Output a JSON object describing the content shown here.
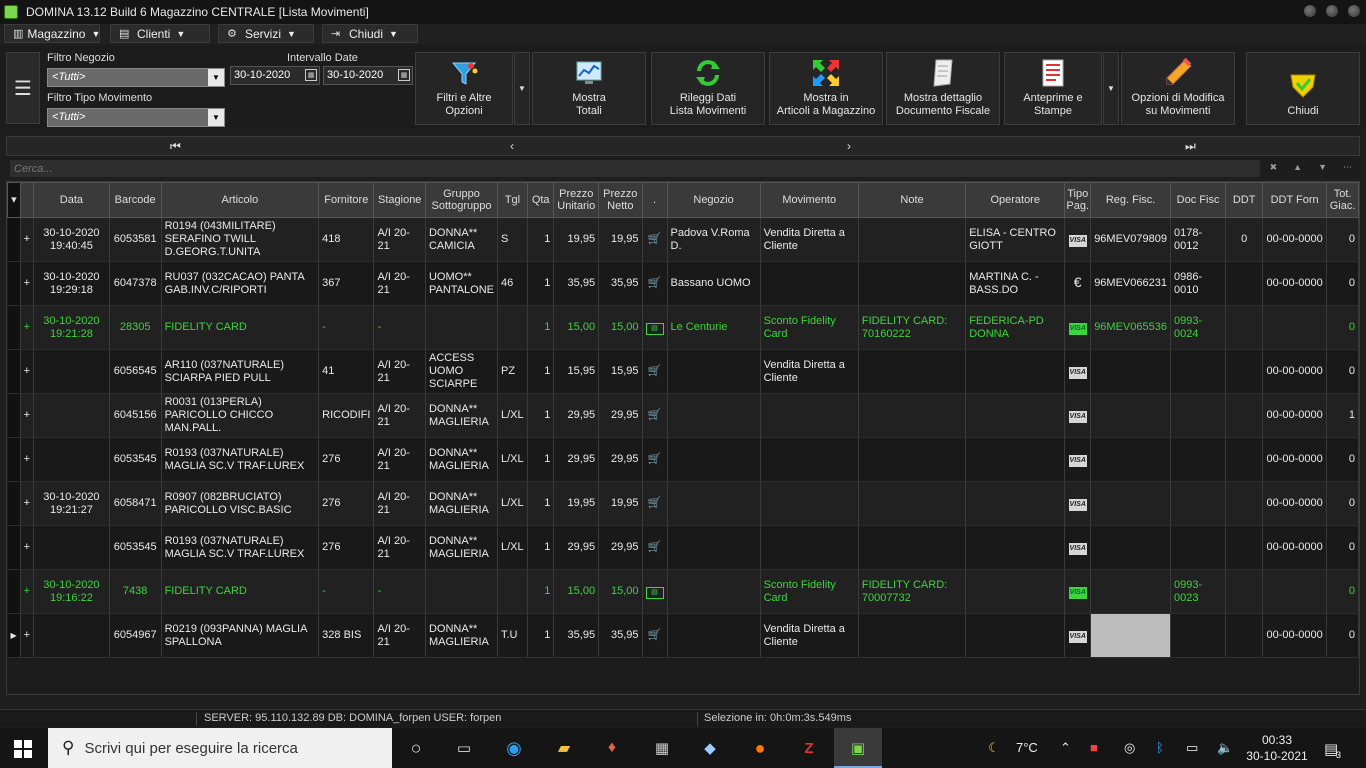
{
  "window": {
    "title": "DOMINA 13.12 Build 6  Magazzino CENTRALE [Lista Movimenti]"
  },
  "menu": [
    {
      "label": "Magazzino",
      "icon": "chart-icon"
    },
    {
      "label": "Clienti",
      "icon": "card-icon"
    },
    {
      "label": "Servizi",
      "icon": "gear-icon"
    },
    {
      "label": "Chiudi",
      "icon": "exit-icon"
    }
  ],
  "filters": {
    "negozio_label": "Filtro Negozio",
    "negozio_value": "<Tutti>",
    "tipo_label": "Filtro Tipo Movimento",
    "tipo_value": "<Tutti>",
    "intervallo_label": "Intervallo Date",
    "date_from": "30-10-2020",
    "date_to": "30-10-2020"
  },
  "toolbar": {
    "filtri": [
      "Filtri e Altre",
      "Opzioni"
    ],
    "totali": [
      "Mostra",
      "Totali"
    ],
    "rileggi": [
      "Rileggi Dati",
      "Lista Movimenti"
    ],
    "articoli": [
      "Mostra in",
      "Articoli a Magazzino"
    ],
    "documento": [
      "Mostra dettaglio",
      "Documento Fiscale"
    ],
    "anteprime": [
      "Anteprime e",
      "Stampe"
    ],
    "opzioni": [
      "Opzioni di Modifica",
      "su Movimenti"
    ],
    "chiudi": "Chiudi"
  },
  "search": {
    "placeholder": "Cerca..."
  },
  "columns": [
    "Data",
    "Barcode",
    "Articolo",
    "Fornitore",
    "Stagione",
    "Gruppo Sottogruppo",
    "Tgl",
    "Qta",
    "Prezzo Unitario",
    "Prezzo Netto",
    ".",
    "Negozio",
    "Movimento",
    "Note",
    "Operatore",
    "Tipo Pag.",
    "Reg. Fisc.",
    "Doc Fisc",
    "DDT",
    "DDT Forn",
    "Tot. Giac."
  ],
  "rows": [
    {
      "data": [
        "30-10-2020",
        "19:40:45"
      ],
      "barcode": "6053581",
      "articolo": "R0194 (043MILITARE) SERAFINO TWILL D.GEORG.T.UNITA",
      "fornitore": "418",
      "stagione": "A/I 20-21",
      "gruppo": "DONNA** CAMICIA",
      "tgl": "S",
      "qta": "1",
      "prezzo_unitario": "19,95",
      "prezzo_netto": "19,95",
      "icon": "cart",
      "negozio": "Padova V.Roma D.",
      "movimento": "Vendita Diretta a Cliente",
      "note": "",
      "operatore": "ELISA - CENTRO GIOTT",
      "pag": "visa",
      "reg_fisc": "96MEV079809",
      "doc_fisc": "0178-0012",
      "ddt": "0",
      "ddt_forn": "00-00-0000",
      "giac": "0",
      "green": false
    },
    {
      "data": [
        "30-10-2020",
        "19:29:18"
      ],
      "barcode": "6047378",
      "articolo": "RU037 (032CACAO) PANTA GAB.INV.C/RIPORTI",
      "fornitore": "367",
      "stagione": "A/I 20-21",
      "gruppo": "UOMO** PANTALONE",
      "tgl": "46",
      "qta": "1",
      "prezzo_unitario": "35,95",
      "prezzo_netto": "35,95",
      "icon": "cart",
      "negozio": "Bassano UOMO",
      "movimento": "",
      "note": "",
      "operatore": "MARTINA C. -BASS.DO",
      "pag": "euro",
      "reg_fisc": "96MEV066231",
      "doc_fisc": "0986-0010",
      "ddt": "",
      "ddt_forn": "00-00-0000",
      "giac": "0",
      "green": false
    },
    {
      "data": [
        "30-10-2020",
        "19:21:28"
      ],
      "barcode": "28305",
      "articolo": "FIDELITY CARD",
      "fornitore": "-",
      "stagione": "-",
      "gruppo": "",
      "tgl": "",
      "qta": "1",
      "prezzo_unitario": "15,00",
      "prezzo_netto": "15,00",
      "icon": "card",
      "negozio": "Le Centurie",
      "movimento": "Sconto Fidelity Card",
      "note": "FIDELITY CARD: 70160222",
      "operatore": "FEDERICA-PD DONNA",
      "pag": "visa",
      "reg_fisc": "96MEV065536",
      "doc_fisc": "0993-0024",
      "ddt": "",
      "ddt_forn": "",
      "giac": "0",
      "green": true
    },
    {
      "data": [
        "",
        ""
      ],
      "barcode": "6056545",
      "articolo": "AR110 (037NATURALE) SCIARPA PIED PULL",
      "fornitore": "41",
      "stagione": "A/I 20-21",
      "gruppo": "ACCESS UOMO SCIARPE",
      "tgl": "PZ",
      "qta": "1",
      "prezzo_unitario": "15,95",
      "prezzo_netto": "15,95",
      "icon": "cart",
      "negozio": "",
      "movimento": "Vendita Diretta a Cliente",
      "note": "",
      "operatore": "",
      "pag": "visa",
      "reg_fisc": "",
      "doc_fisc": "",
      "ddt": "",
      "ddt_forn": "00-00-0000",
      "giac": "0",
      "green": false
    },
    {
      "data": [
        "",
        ""
      ],
      "barcode": "6045156",
      "articolo": "R0031 (013PERLA) PARICOLLO CHICCO MAN.PALL.",
      "fornitore": "RICODIFI",
      "stagione": "A/I 20-21",
      "gruppo": "DONNA** MAGLIERIA",
      "tgl": "L/XL",
      "qta": "1",
      "prezzo_unitario": "29,95",
      "prezzo_netto": "29,95",
      "icon": "cart",
      "negozio": "",
      "movimento": "",
      "note": "",
      "operatore": "",
      "pag": "visa",
      "reg_fisc": "",
      "doc_fisc": "",
      "ddt": "",
      "ddt_forn": "00-00-0000",
      "giac": "1",
      "green": false
    },
    {
      "data": [
        "",
        ""
      ],
      "barcode": "6053545",
      "articolo": "R0193 (037NATURALE) MAGLIA SC.V TRAF.LUREX",
      "fornitore": "276",
      "stagione": "A/I 20-21",
      "gruppo": "DONNA** MAGLIERIA",
      "tgl": "L/XL",
      "qta": "1",
      "prezzo_unitario": "29,95",
      "prezzo_netto": "29,95",
      "icon": "cart",
      "negozio": "",
      "movimento": "",
      "note": "",
      "operatore": "",
      "pag": "visa",
      "reg_fisc": "",
      "doc_fisc": "",
      "ddt": "",
      "ddt_forn": "00-00-0000",
      "giac": "0",
      "green": false
    },
    {
      "data": [
        "30-10-2020",
        "19:21:27"
      ],
      "barcode": "6058471",
      "articolo": "R0907 (082BRUCIATO) PARICOLLO VISC.BASIC",
      "fornitore": "276",
      "stagione": "A/I 20-21",
      "gruppo": "DONNA** MAGLIERIA",
      "tgl": "L/XL",
      "qta": "1",
      "prezzo_unitario": "19,95",
      "prezzo_netto": "19,95",
      "icon": "cart",
      "negozio": "",
      "movimento": "",
      "note": "",
      "operatore": "",
      "pag": "visa",
      "reg_fisc": "",
      "doc_fisc": "",
      "ddt": "",
      "ddt_forn": "00-00-0000",
      "giac": "0",
      "green": false
    },
    {
      "data": [
        "",
        ""
      ],
      "barcode": "6053545",
      "articolo": "R0193 (037NATURALE) MAGLIA SC.V TRAF.LUREX",
      "fornitore": "276",
      "stagione": "A/I 20-21",
      "gruppo": "DONNA** MAGLIERIA",
      "tgl": "L/XL",
      "qta": "1",
      "prezzo_unitario": "29,95",
      "prezzo_netto": "29,95",
      "icon": "cart",
      "negozio": "",
      "movimento": "",
      "note": "",
      "operatore": "",
      "pag": "visa",
      "reg_fisc": "",
      "doc_fisc": "",
      "ddt": "",
      "ddt_forn": "00-00-0000",
      "giac": "0",
      "green": false
    },
    {
      "data": [
        "30-10-2020",
        "19:16:22"
      ],
      "barcode": "7438",
      "articolo": "FIDELITY CARD",
      "fornitore": "-",
      "stagione": "-",
      "gruppo": "",
      "tgl": "",
      "qta": "1",
      "prezzo_unitario": "15,00",
      "prezzo_netto": "15,00",
      "icon": "card",
      "negozio": "",
      "movimento": "Sconto Fidelity Card",
      "note": "FIDELITY CARD: 70007732",
      "operatore": "",
      "pag": "visa",
      "reg_fisc": "",
      "doc_fisc": "0993-0023",
      "ddt": "",
      "ddt_forn": "",
      "giac": "0",
      "green": true
    },
    {
      "data": [
        "",
        ""
      ],
      "barcode": "6054967",
      "articolo": "R0219 (093PANNA) MAGLIA SPALLONA",
      "fornitore": "328 BIS",
      "stagione": "A/I 20-21",
      "gruppo": "DONNA** MAGLIERIA",
      "tgl": "T.U",
      "qta": "1",
      "prezzo_unitario": "35,95",
      "prezzo_netto": "35,95",
      "icon": "cart",
      "negozio": "",
      "movimento": "Vendita Diretta a Cliente",
      "note": "",
      "operatore": "",
      "pag": "visa",
      "reg_fisc": "",
      "doc_fisc": "",
      "ddt": "",
      "ddt_forn": "00-00-0000",
      "giac": "0",
      "green": false
    }
  ],
  "status": {
    "server": "SERVER: 95.110.132.89 DB: DOMINA_forpen USER: forpen",
    "selezione": "Selezione in: 0h:0m:3s.549ms"
  },
  "taskbar": {
    "search_placeholder": "Scrivi qui per eseguire la ricerca",
    "weather": "7°C",
    "time": "00:33",
    "date": "30-10-2021",
    "notifications": "3"
  },
  "colors": {
    "green": "#3fd33f",
    "background": "#1e1e1e"
  }
}
